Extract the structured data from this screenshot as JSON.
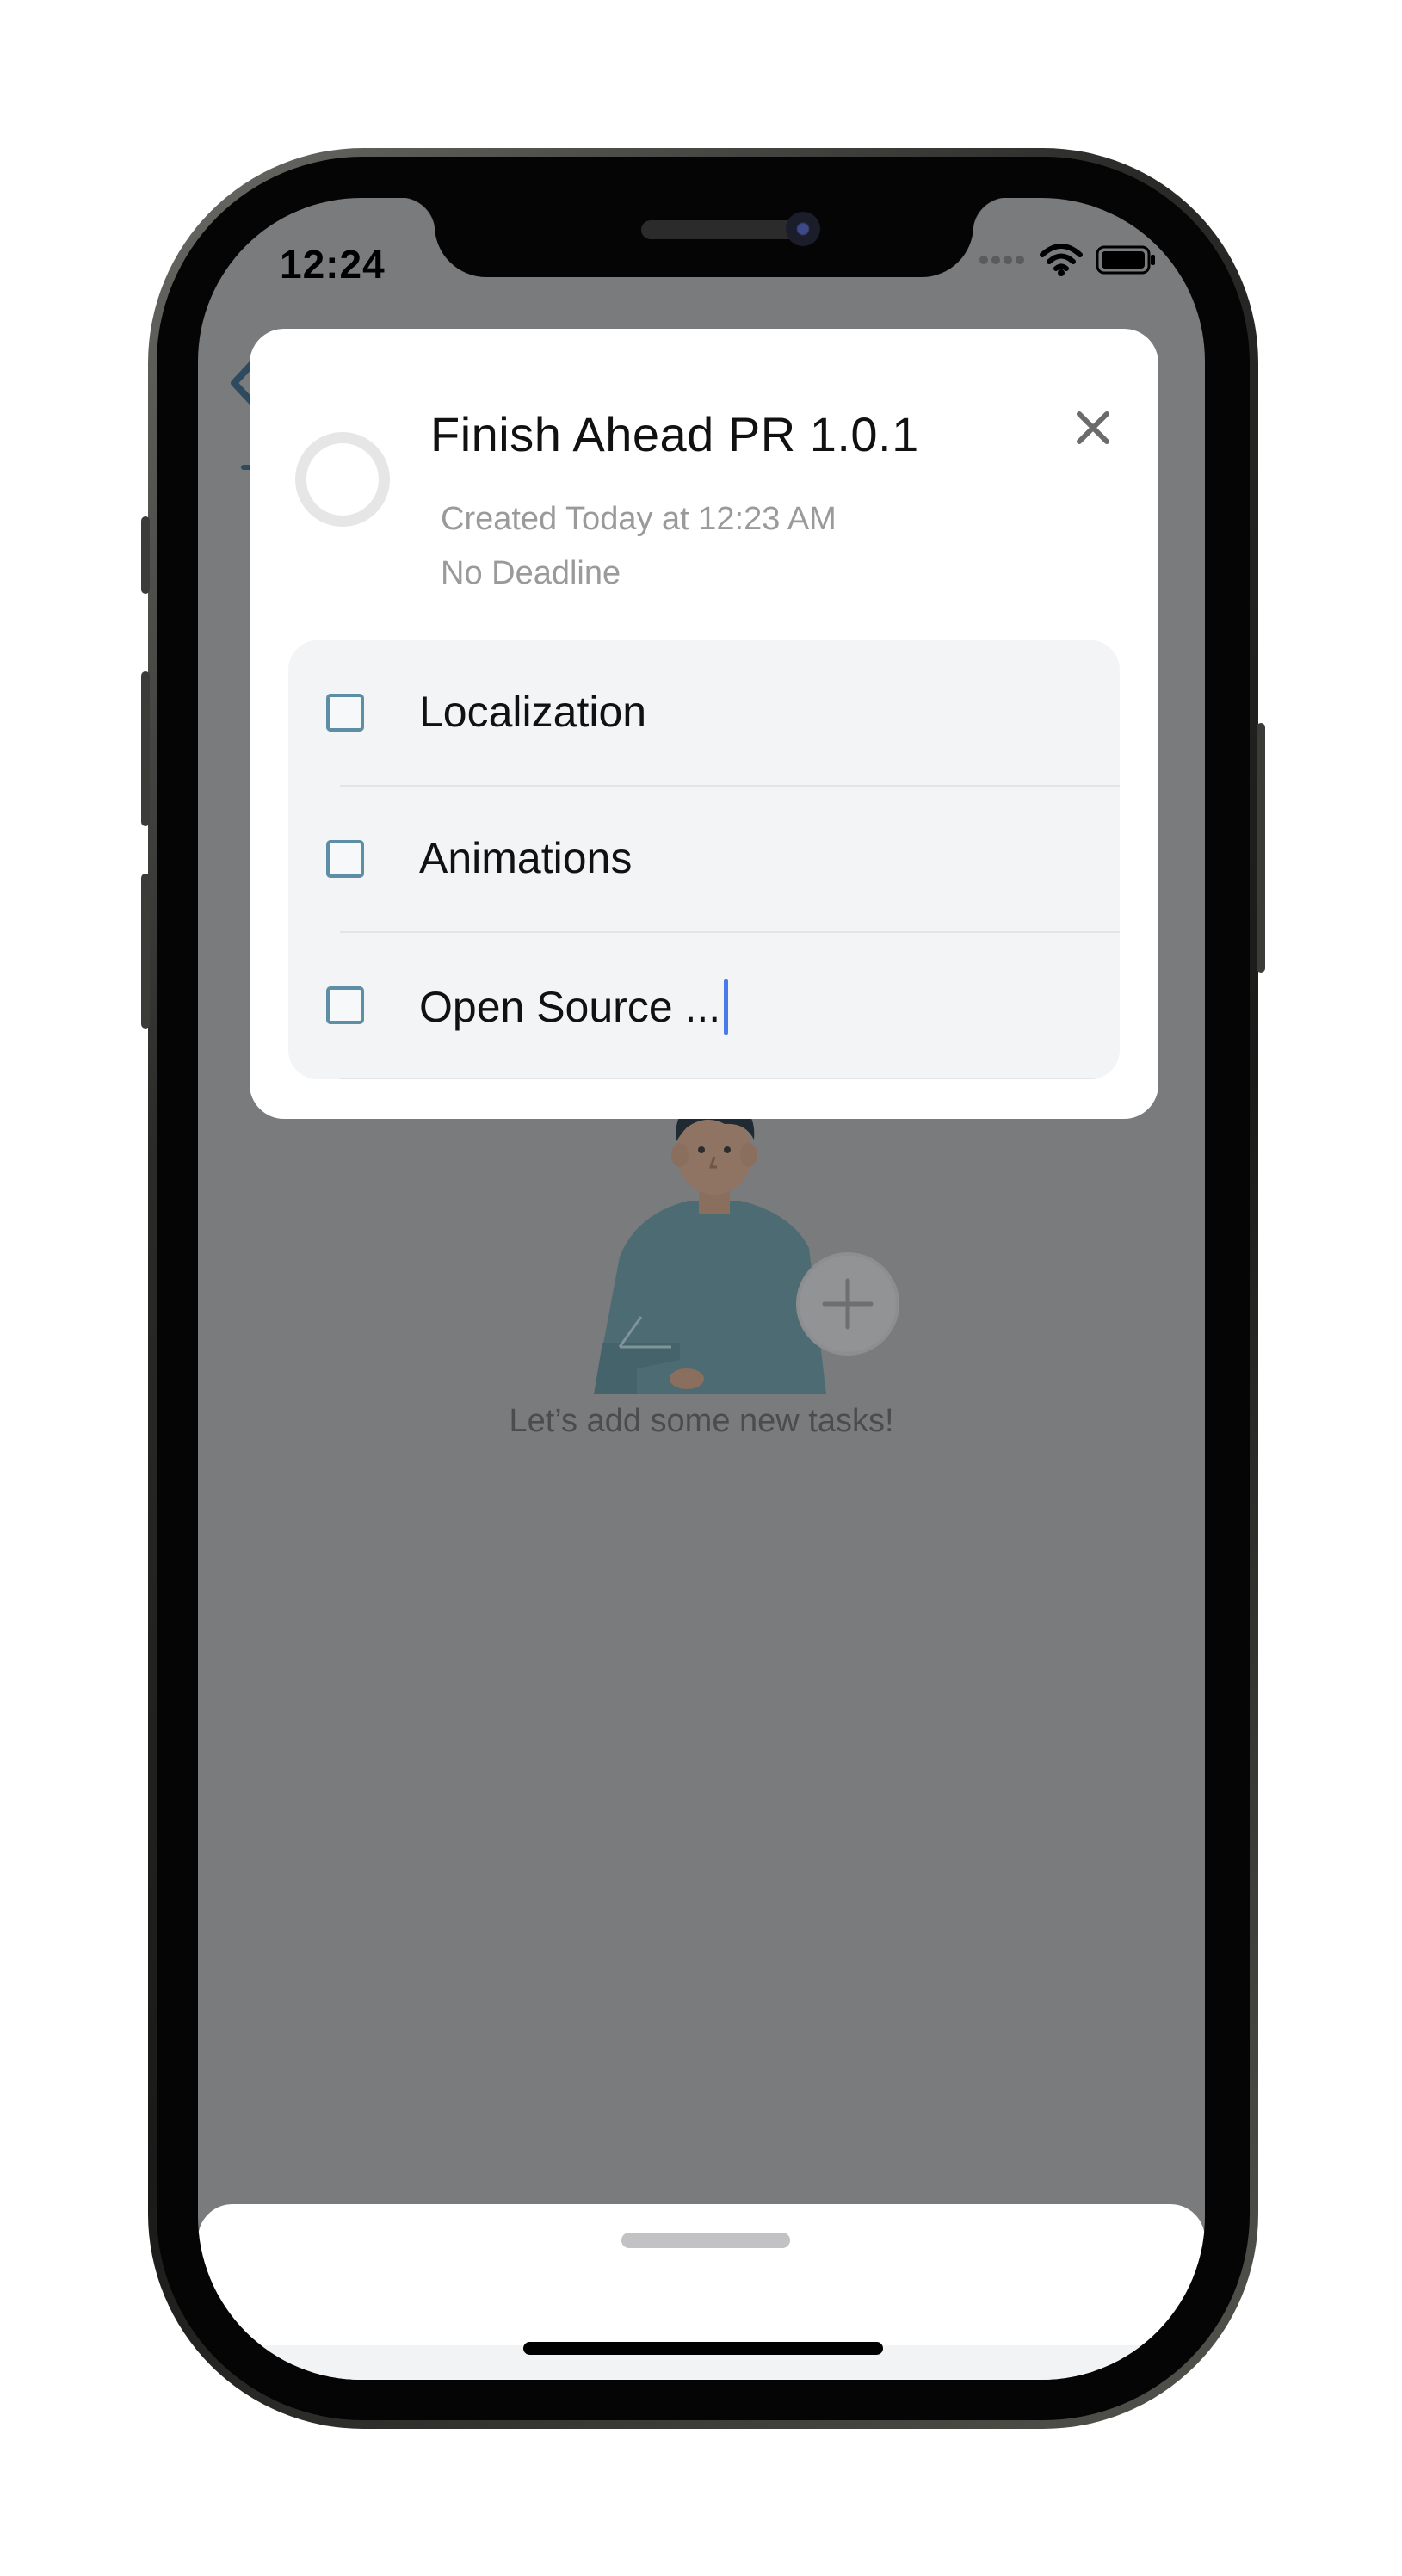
{
  "status_bar": {
    "time": "12:24"
  },
  "background": {
    "empty_state_text": "Let’s add some new tasks!"
  },
  "task_detail": {
    "title": "Finish Ahead PR 1.0.1",
    "created": "Created Today at 12:23 AM",
    "deadline": "No Deadline",
    "progress": 0,
    "subtasks": [
      {
        "label": "Localization",
        "checked": false
      },
      {
        "label": "Animations",
        "checked": false
      },
      {
        "label": "Open Source ...",
        "checked": false
      }
    ]
  },
  "colors": {
    "overlay": "#7a7b7d",
    "checkbox_border": "#5e8ea6",
    "caret": "#4a79e8",
    "card_background": "#ffffff",
    "checklist_background": "#f3f4f6"
  },
  "icons": {
    "back": "chevron-left-icon",
    "close": "close-icon",
    "add": "plus-icon",
    "wifi": "wifi-icon",
    "battery": "battery-icon",
    "signal": "signal-icon"
  }
}
